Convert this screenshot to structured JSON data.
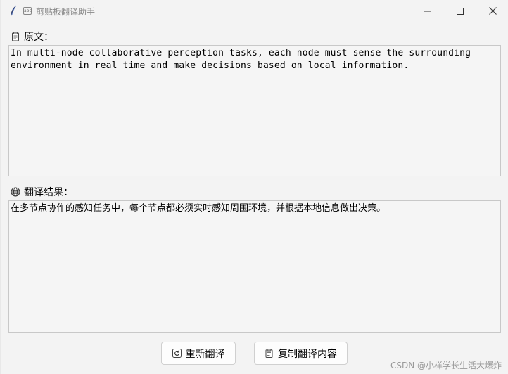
{
  "window": {
    "title": "剪贴板翻译助手",
    "app_icon_text": "abc"
  },
  "original": {
    "label": "原文：",
    "icon": "clipboard-icon",
    "text": "In multi-node collaborative perception tasks, each node must sense the surrounding\nenvironment in real time and make decisions based on local information."
  },
  "result": {
    "label": "翻译结果：",
    "icon": "globe-icon",
    "text": "在多节点协作的感知任务中，每个节点都必须实时感知周围环境，并根据本地信息做出决策。"
  },
  "buttons": {
    "retranslate_label": "重新翻译",
    "retranslate_icon": "refresh-icon",
    "copy_label": "复制翻译内容",
    "copy_icon": "clipboard-icon"
  },
  "watermark": "CSDN @小样学长生活大爆炸",
  "colors": {
    "window_bg": "#f3f3f3",
    "textbox_bg": "#f5f5f5",
    "border": "#c8c8c8",
    "title_text": "#888888"
  }
}
